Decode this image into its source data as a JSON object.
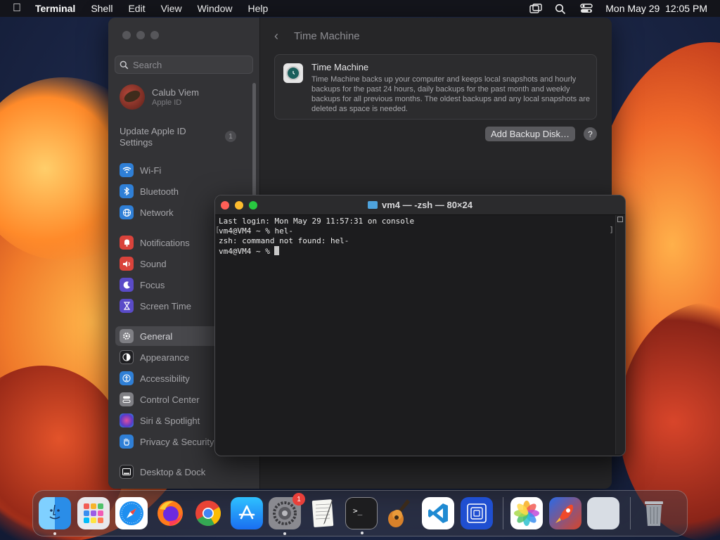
{
  "menubar": {
    "apple_icon": "apple-logo-icon",
    "app_name": "Terminal",
    "menus": [
      "Shell",
      "Edit",
      "View",
      "Window",
      "Help"
    ],
    "datetime": "Mon May 29  12:05 PM"
  },
  "settings": {
    "search_placeholder": "Search",
    "profile": {
      "name": "Calub Viem",
      "subtitle": "Apple ID"
    },
    "update": {
      "label": "Update Apple ID Settings",
      "badge": "1"
    },
    "sidebar": [
      {
        "label": "Wi-Fi",
        "icon": "wifi-icon",
        "color": "#2f7fd6"
      },
      {
        "label": "Bluetooth",
        "icon": "bluetooth-icon",
        "color": "#2f7fd6"
      },
      {
        "label": "Network",
        "icon": "globe-icon",
        "color": "#2f7fd6"
      },
      {
        "label": "Notifications",
        "icon": "bell-icon",
        "color": "#d9433b"
      },
      {
        "label": "Sound",
        "icon": "speaker-icon",
        "color": "#d9433b"
      },
      {
        "label": "Focus",
        "icon": "moon-icon",
        "color": "#5a4bc8"
      },
      {
        "label": "Screen Time",
        "icon": "hourglass-icon",
        "color": "#5a4bc8"
      },
      {
        "label": "General",
        "icon": "gear-icon",
        "color": "#7f7f84"
      },
      {
        "label": "Appearance",
        "icon": "appearance-icon",
        "color": "#1f1f22"
      },
      {
        "label": "Accessibility",
        "icon": "accessibility-icon",
        "color": "#2f7fd6"
      },
      {
        "label": "Control Center",
        "icon": "control-center-icon",
        "color": "#7f7f84"
      },
      {
        "label": "Siri & Spotlight",
        "icon": "siri-icon",
        "color": "#8a3fb8"
      },
      {
        "label": "Privacy & Security",
        "icon": "hand-icon",
        "color": "#2f7fd6"
      },
      {
        "label": "Desktop & Dock",
        "icon": "dock-icon",
        "color": "#1f1f22"
      }
    ],
    "header_title": "Time Machine",
    "card": {
      "title": "Time Machine",
      "description": "Time Machine backs up your computer and keeps local snapshots and hourly backups for the past 24 hours, daily backups for the past month and weekly backups for all previous months. The oldest backups and any local snapshots are deleted as space is needed."
    },
    "add_button": "Add Backup Disk…",
    "help_button": "?"
  },
  "terminal": {
    "title": "vm4 — -zsh — 80×24",
    "lines": [
      "Last login: Mon May 29 11:57:31 on console",
      "vm4@VM4 ~ % hel-",
      "zsh: command not found: hel-",
      "vm4@VM4 ~ % "
    ]
  },
  "dock": {
    "apps": [
      {
        "name": "Finder",
        "icon": "finder-icon",
        "running": true
      },
      {
        "name": "Launchpad",
        "icon": "launchpad-icon",
        "running": false
      },
      {
        "name": "Safari",
        "icon": "safari-icon",
        "running": false
      },
      {
        "name": "Firefox",
        "icon": "firefox-icon",
        "running": false
      },
      {
        "name": "Chrome",
        "icon": "chrome-icon",
        "running": false
      },
      {
        "name": "App Store",
        "icon": "app-store-icon",
        "running": false
      },
      {
        "name": "System Settings",
        "icon": "system-settings-icon",
        "running": true,
        "badge": "1"
      },
      {
        "name": "TextEdit",
        "icon": "textedit-icon",
        "running": false
      },
      {
        "name": "Terminal",
        "icon": "terminal-icon",
        "running": true
      },
      {
        "name": "GarageBand",
        "icon": "garageband-icon",
        "running": false
      },
      {
        "name": "VS Code",
        "icon": "vscode-icon",
        "running": false
      },
      {
        "name": "UTM",
        "icon": "utm-icon",
        "running": false
      }
    ],
    "recent": [
      {
        "name": "Photos",
        "icon": "photos-icon"
      },
      {
        "name": "Migration",
        "icon": "rocket-icon"
      },
      {
        "name": "Blank App",
        "icon": "blank-app-icon"
      }
    ],
    "trash_icon": "trash-icon"
  }
}
